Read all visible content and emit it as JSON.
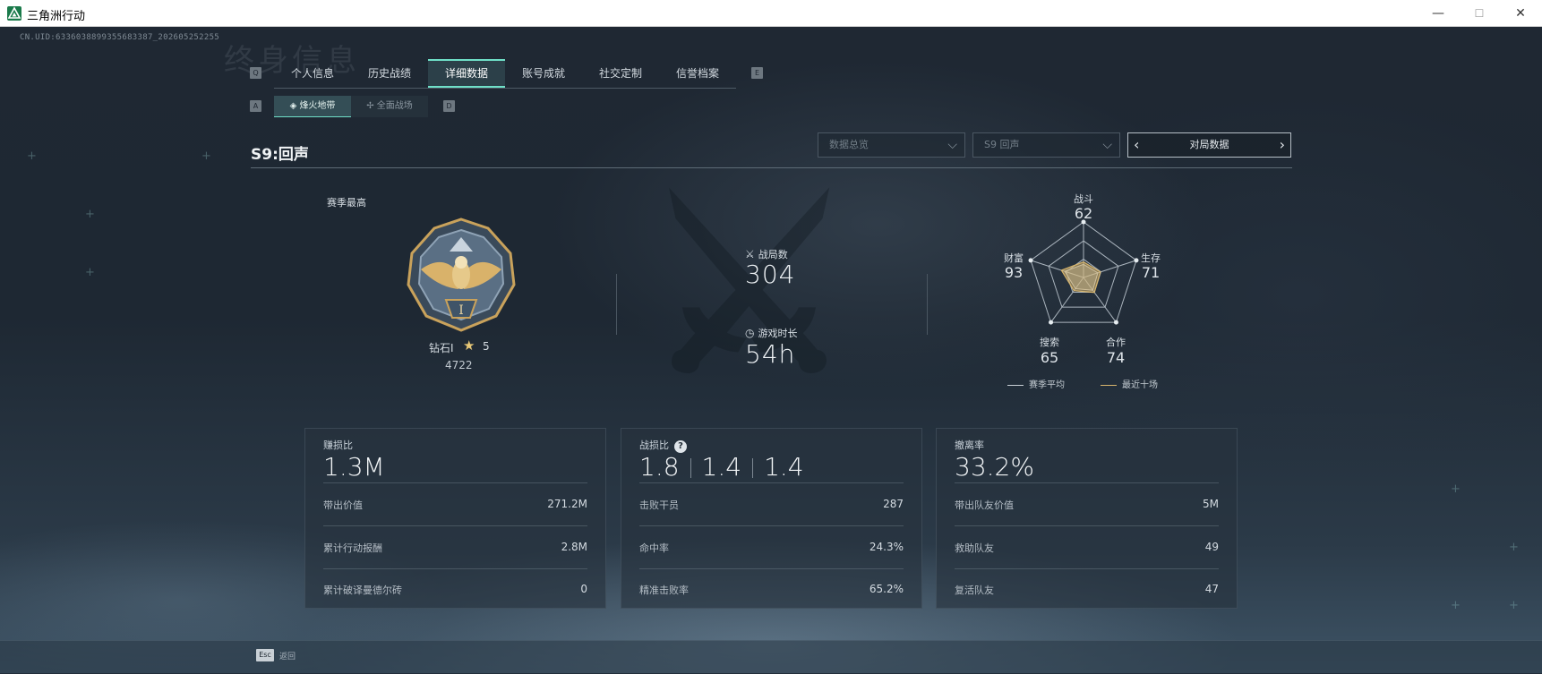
{
  "window": {
    "title": "三角洲行动",
    "minimize": "—",
    "maximize": "☐",
    "close": "✕"
  },
  "uid": "CN.UID:6336038899355683387_202605252255",
  "ghost_title": "终身信息",
  "tabs": {
    "prev_key": "Q",
    "next_key": "E",
    "items": [
      {
        "label": "个人信息"
      },
      {
        "label": "历史战绩"
      },
      {
        "label": "详细数据"
      },
      {
        "label": "账号成就"
      },
      {
        "label": "社交定制"
      },
      {
        "label": "信誉档案"
      }
    ],
    "active_index": 2
  },
  "subtabs": {
    "prev_key": "A",
    "next_key": "D",
    "items": [
      {
        "label": "烽火地带"
      },
      {
        "label": "全面战场"
      }
    ],
    "active_index": 0
  },
  "season": {
    "title": "S9:回声"
  },
  "filters": {
    "data_overview": "数据总览",
    "season": "S9 回声",
    "match_data": "对局数据"
  },
  "rank": {
    "label": "赛季最高",
    "name": "钻石I",
    "stars": "5",
    "score": "4722",
    "emblem_numeral": "I"
  },
  "stats": {
    "matches_label": "战局数",
    "matches_value": "304",
    "playtime_label": "游戏时长",
    "playtime_value": "54h"
  },
  "radar": {
    "axes": [
      {
        "label": "战斗",
        "value": "62"
      },
      {
        "label": "生存",
        "value": "71"
      },
      {
        "label": "合作",
        "value": "74"
      },
      {
        "label": "搜索",
        "value": "65"
      },
      {
        "label": "财富",
        "value": "93"
      }
    ],
    "legend": [
      {
        "label": "赛季平均",
        "color": "#c9d0d6"
      },
      {
        "label": "最近十场",
        "color": "#d7b56d"
      }
    ]
  },
  "cards": [
    {
      "head": "赚损比",
      "big": "1.3M",
      "rows": [
        {
          "label": "带出价值",
          "value": "271.2M"
        },
        {
          "label": "累计行动报酬",
          "value": "2.8M"
        },
        {
          "label": "累计破译曼德尔砖",
          "value": "0"
        }
      ]
    },
    {
      "head": "战损比",
      "help": "?",
      "big_parts": [
        "1.8",
        "1.4",
        "1.4"
      ],
      "rows": [
        {
          "label": "击败干员",
          "value": "287"
        },
        {
          "label": "命中率",
          "value": "24.3%"
        },
        {
          "label": "精准击败率",
          "value": "65.2%"
        }
      ]
    },
    {
      "head": "撤离率",
      "big": "33.2%",
      "rows": [
        {
          "label": "带出队友价值",
          "value": "5M"
        },
        {
          "label": "救助队友",
          "value": "49"
        },
        {
          "label": "复活队友",
          "value": "47"
        }
      ]
    }
  ],
  "footer": {
    "esc_key": "Esc",
    "back_label": "返回"
  },
  "colors": {
    "accent": "#6fe0c8",
    "gold": "#d7b56d"
  }
}
